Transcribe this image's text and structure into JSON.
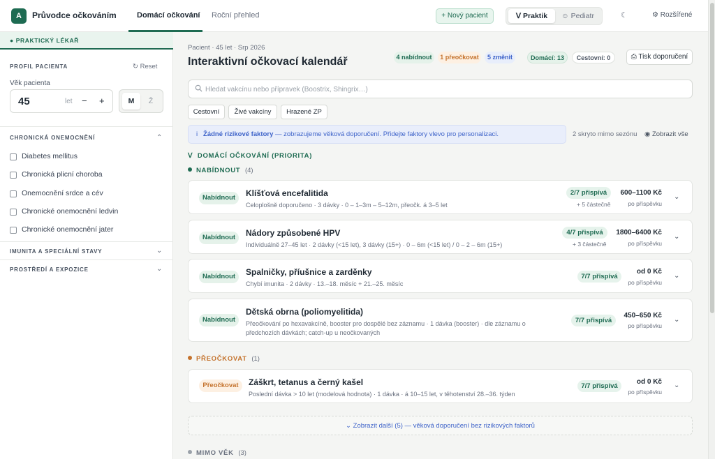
{
  "app": {
    "logo_letter": "A",
    "title": "Průvodce očkováním",
    "tabs": [
      {
        "label": "Domácí očkování",
        "active": true
      },
      {
        "label": "Roční přehled",
        "active": false
      }
    ],
    "new_patient_label": "+ Nový pacient",
    "roles": [
      {
        "label": "Praktik",
        "active": true
      },
      {
        "label": "Pediatr",
        "active": false
      }
    ],
    "theme_icon": "moon-icon",
    "advanced_label": "Rozšířené"
  },
  "sidebar": {
    "role_banner": "PRAKTICKÝ LÉKAŘ",
    "profile_heading": "PROFIL PACIENTA",
    "reset_label": "Reset",
    "age_label": "Věk pacienta",
    "age_value": "45",
    "age_unit": "let",
    "age_minus": "−",
    "age_plus": "+",
    "sex_options": [
      {
        "label": "M",
        "active": true
      },
      {
        "label": "Ž",
        "active": false
      }
    ],
    "chronic_heading": "CHRONICKÁ ONEMOCNĚNÍ",
    "chronic_items": [
      "Diabetes mellitus",
      "Chronická plicní choroba",
      "Onemocnění srdce a cév",
      "Chronické onemocnění ledvin",
      "Chronické onemocnění jater"
    ],
    "immunity_heading": "IMUNITA A SPECIÁLNÍ STAVY",
    "environment_heading": "PROSTŘEDÍ A EXPOZICE"
  },
  "main": {
    "subtitle": "Pacient · 45 let · Srp 2026",
    "title": "Interaktivní očkovací kalendář",
    "summary_pills": [
      {
        "label": "4 nabídnout",
        "style": "g"
      },
      {
        "label": "1 přeočkovat",
        "style": "o"
      },
      {
        "label": "5 změnit",
        "style": "b"
      },
      {
        "label": "Domácí: 13",
        "style": "dg"
      },
      {
        "label": "Cestovní: 0",
        "style": "gr"
      }
    ],
    "print_label": "Tisk doporučení",
    "search_placeholder": "Hledat vakcínu nebo přípravek (Boostrix, Shingrix…)",
    "filter_chips": [
      "Cestovní",
      "Živé vakcíny",
      "Hrazené ZP"
    ],
    "info_icon": "i",
    "info_bold": "Žádné rizikové faktory",
    "info_text": " — zobrazujeme věková doporučení. Přidejte faktory vlevo pro personalizaci.",
    "hidden_note": "2 skryto mimo sezónu",
    "show_all_label": "Zobrazit vše",
    "domestic_heading": "DOMÁCÍ OČKOVÁNÍ (PRIORITA)",
    "offer_group": {
      "label": "NABÍDNOUT",
      "count": "(4)",
      "color": "#1e6b52"
    },
    "recheck_group": {
      "label": "PŘEOČKOVAT",
      "count": "(1)",
      "color": "#c4722c"
    },
    "age_group": {
      "label": "MIMO VĚK",
      "count": "(3)",
      "color": "#6b7280"
    },
    "offer_cards": [
      {
        "badge": "Nabídnout",
        "title": "Klíšťová encefalitida",
        "subtitle": "Celoplošně doporučeno · 3 dávky · 0 – 1–3m – 5–12m, přeočk. á 3–5 let",
        "contrib": "2/7 přispívá",
        "partial": "+ 5 částečně",
        "price": "600–1100 Kč",
        "price_note": "po příspěvku"
      },
      {
        "badge": "Nabídnout",
        "title": "Nádory způsobené HPV",
        "subtitle": "Individuálně 27–45 let · 2 dávky (<15 let), 3 dávky (15+) · 0 – 6m (<15 let) / 0 – 2 – 6m (15+)",
        "contrib": "4/7 přispívá",
        "partial": "+ 3 částečně",
        "price": "1800–6400 Kč",
        "price_note": "po příspěvku"
      },
      {
        "badge": "Nabídnout",
        "title": "Spalničky, příušnice a zarděnky",
        "subtitle": "Chybí imunita · 2 dávky · 13.–18. měsíc + 21.–25. měsíc",
        "contrib": "7/7 přispívá",
        "partial": "",
        "price": "od 0 Kč",
        "price_note": "po příspěvku"
      },
      {
        "badge": "Nabídnout",
        "title": "Dětská obrna (poliomyelitida)",
        "subtitle_line1": "Přeočkování po hexavakcíně, booster pro dospělé bez záznamu · 1 dávka (booster) · dle záznamu o",
        "subtitle_line2": "předchozích dávkách; catch-up u neočkovaných",
        "contrib": "7/7 přispívá",
        "partial": "",
        "price": "450–650 Kč",
        "price_note": "po příspěvku"
      }
    ],
    "recheck_cards": [
      {
        "badge": "Přeočkovat",
        "title": "Záškrt, tetanus a černý kašel",
        "subtitle": "Poslední dávka > 10 let (modelová hodnota) · 1 dávka · á 10–15 let, v těhotenství 28.–36. týden",
        "contrib": "7/7 přispívá",
        "price": "od 0 Kč",
        "price_note": "po příspěvku"
      }
    ],
    "show_more_label": "Zobrazit další (5) — věková doporučení bez rizikových faktorů"
  }
}
